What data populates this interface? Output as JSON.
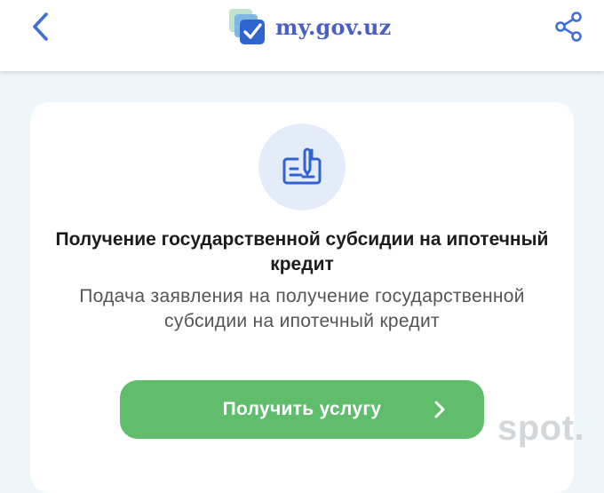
{
  "header": {
    "back_icon": "chevron-left-icon",
    "logo_text": "my.gov.uz",
    "logo_icon": "checkbox-stack-icon",
    "share_icon": "share-icon",
    "accent_color": "#3e6fd8"
  },
  "service": {
    "icon": "signed-check-document-icon",
    "title": "Получение государственной субсидии на ипотечный кредит",
    "description": "Подача заявления на получение государственной субсидии на ипотечный кредит",
    "cta_label": "Получить услугу",
    "cta_icon": "chevron-right-icon",
    "cta_color": "#5fbd6c"
  },
  "watermark": {
    "text": "spot."
  }
}
